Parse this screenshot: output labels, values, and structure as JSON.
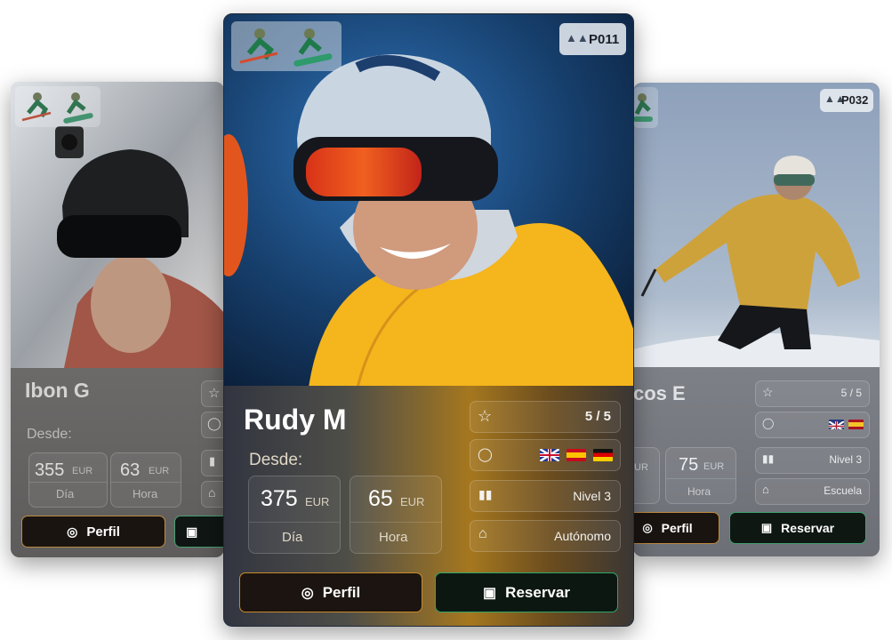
{
  "cards": {
    "left": {
      "name": "Ibon G",
      "from_label": "Desde:",
      "price_day": "355",
      "price_hour": "63",
      "currency": "EUR",
      "day_label": "Día",
      "hour_label": "Hora",
      "profile_button": "Perfil",
      "sports": [
        "ski-icon",
        "snowboard-icon"
      ]
    },
    "center": {
      "name": "Rudy M",
      "code": "P011",
      "from_label": "Desde:",
      "price_day": "375",
      "price_hour": "65",
      "currency": "EUR",
      "day_label": "Día",
      "hour_label": "Hora",
      "rating": "5 / 5",
      "languages": [
        "gb-flag",
        "es-flag",
        "de-flag"
      ],
      "level": "Nivel 3",
      "type": "Autónomo",
      "profile_button": "Perfil",
      "book_button": "Reservar",
      "sports": [
        "ski-icon",
        "snowboard-icon"
      ]
    },
    "right": {
      "name_partial": "cos E",
      "code": "P032",
      "price_day_partial": "UR",
      "price_hour": "75",
      "currency": "EUR",
      "hour_label": "Hora",
      "rating": "5 / 5",
      "languages": [
        "gb-flag",
        "es-flag"
      ],
      "level": "Nivel 3",
      "type": "Escuela",
      "profile_button": "Perfil",
      "book_button": "Reservar"
    }
  },
  "colors": {
    "accent_orange": "#c98a2c",
    "accent_green": "#2fa76a",
    "jacket_yellow": "#f5b51c"
  }
}
